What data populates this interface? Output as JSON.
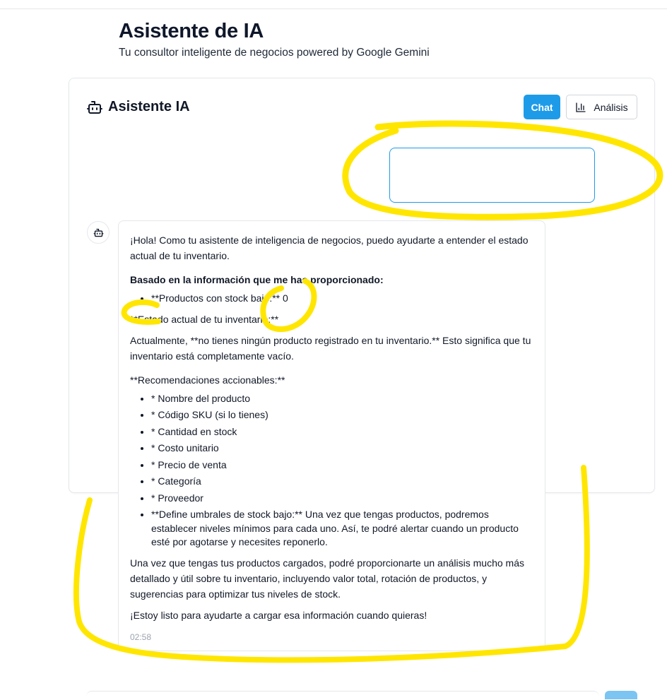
{
  "header": {
    "title": "Asistente de IA",
    "subtitle": "Tu consultor inteligente de negocios powered by Google Gemini"
  },
  "card": {
    "title": "Asistente IA",
    "tabs": {
      "chat_label": "Chat",
      "analysis_label": "Análisis"
    },
    "active_tab_color": "#1e9be8"
  },
  "user_message": {
    "text": ""
  },
  "bot_message": {
    "intro": "¡Hola! Como tu asistente de inteligencia de negocios, puedo ayudarte a entender el estado actual de tu inventario.",
    "based_on": "Basado en la información que me has proporcionado:",
    "stock_item": "**Productos con stock bajo:** 0",
    "state_heading": "**Estado actual de tu inventario:**",
    "state_text": "Actualmente, **no tienes ningún producto registrado en tu inventario.** Esto significa que tu inventario está completamente vacío.",
    "recommendations_heading": "**Recomendaciones accionables:**",
    "recommendations": [
      "* Nombre del producto",
      "* Código SKU (si lo tienes)",
      "* Cantidad en stock",
      "* Costo unitario",
      "* Precio de venta",
      "* Categoría",
      "* Proveedor",
      "**Define umbrales de stock bajo:** Una vez que tengas productos, podremos establecer niveles mínimos para cada uno. Así, te podré alertar cuando un producto esté por agotarse y necesites reponerlo."
    ],
    "closing": "Una vez que tengas tus productos cargados, podré proporcionarte un análisis mucho más detallado y útil sobre tu inventario, incluyendo valor total, rotación de productos, y sugerencias para optimizar tus niveles de stock.",
    "farewell": "¡Estoy listo para ayudarte a cargar esa información cuando quieras!",
    "time": "02:58"
  },
  "icons": {
    "card_header": "robot-icon",
    "bot_avatar": "robot-icon",
    "analysis": "bar-chart-icon"
  },
  "annotation_color": "#ffe600"
}
